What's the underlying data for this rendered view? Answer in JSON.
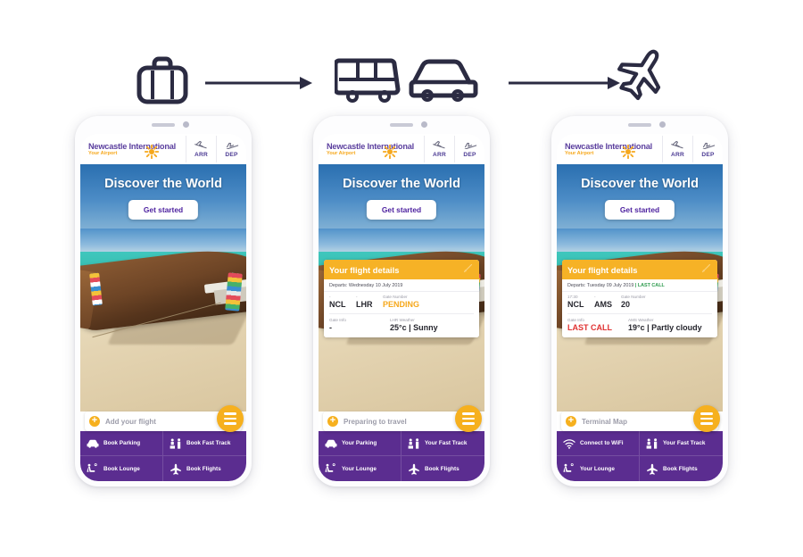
{
  "flow": {
    "steps": [
      {
        "name": "suitcase-icon",
        "label": "suitcase"
      },
      {
        "name": "arrow-1",
        "label": "arrow-right"
      },
      {
        "name": "bus-icon",
        "label": "bus"
      },
      {
        "name": "car-icon",
        "label": "car"
      },
      {
        "name": "arrow-2",
        "label": "arrow-right"
      },
      {
        "name": "plane-icon",
        "label": "airplane"
      }
    ],
    "stroke_color": "#2b2b42"
  },
  "brand": {
    "line1": "Newcastle International",
    "line2": "Your Airport",
    "color_primary": "#5b3f9e",
    "color_accent": "#f6a81c",
    "sun_icon": "sun-icon"
  },
  "header_buttons": [
    {
      "icon": "arrivals-plane-icon",
      "label": "ARR"
    },
    {
      "icon": "departures-plane-icon",
      "label": "DEP"
    }
  ],
  "hero": {
    "title": "Discover the World",
    "cta": "Get started"
  },
  "phones": [
    {
      "id": "phone-1",
      "has_flight_card": false,
      "addbar": {
        "plus": "+",
        "text": "Add your flight",
        "menu_icon": "hamburger-menu-icon"
      },
      "tiles": [
        {
          "icon": "car-icon",
          "label": "Book Parking"
        },
        {
          "icon": "fast-track-icon",
          "label": "Book Fast Track"
        },
        {
          "icon": "lounge-seat-icon",
          "label": "Book Lounge"
        },
        {
          "icon": "plane-icon",
          "label": "Book Flights"
        }
      ]
    },
    {
      "id": "phone-2",
      "has_flight_card": true,
      "card": {
        "title": "Your flight details",
        "edit_icon": "edit-pencil-icon",
        "departs_prefix": "Departs:",
        "departs_date": "Wednesday 10 July 2019",
        "departs_status": "",
        "origin_time": "-",
        "origin_code": "NCL",
        "dest_time": "-",
        "dest_code": "LHR",
        "gate_number_label": "Gate Number",
        "gate_number_value": "PENDING",
        "gate_number_state": "pending",
        "gate_info_label": "Gate Info",
        "gate_info_value": "-",
        "gate_info_state": "normal",
        "weather_label": "LHR Weather",
        "weather_value": "25°c  |  Sunny"
      },
      "addbar": {
        "plus": "+",
        "text": "Preparing to travel",
        "menu_icon": "hamburger-menu-icon"
      },
      "tiles": [
        {
          "icon": "car-icon",
          "label": "Your Parking"
        },
        {
          "icon": "fast-track-icon",
          "label": "Your Fast Track"
        },
        {
          "icon": "lounge-seat-icon",
          "label": "Your Lounge"
        },
        {
          "icon": "plane-icon",
          "label": "Book Flights"
        }
      ]
    },
    {
      "id": "phone-3",
      "has_flight_card": true,
      "card": {
        "title": "Your flight details",
        "edit_icon": "edit-pencil-icon",
        "departs_prefix": "Departs:",
        "departs_date": "Tuesday 09 July 2019",
        "departs_status": "| LAST CALL",
        "origin_time": "17:30",
        "origin_code": "NCL",
        "dest_time": "-",
        "dest_code": "AMS",
        "gate_number_label": "Gate Number",
        "gate_number_value": "20",
        "gate_number_state": "normal",
        "gate_info_label": "Gate Info",
        "gate_info_value": "LAST CALL",
        "gate_info_state": "lastcall",
        "weather_label": "AMS Weather",
        "weather_value": "19°c  |  Partly cloudy"
      },
      "addbar": {
        "plus": "+",
        "text": "Terminal Map",
        "menu_icon": "hamburger-menu-icon"
      },
      "tiles": [
        {
          "icon": "wifi-icon",
          "label": "Connect to WiFi"
        },
        {
          "icon": "fast-track-icon",
          "label": "Your Fast Track"
        },
        {
          "icon": "lounge-seat-icon",
          "label": "Your Lounge"
        },
        {
          "icon": "plane-icon",
          "label": "Book Flights"
        }
      ]
    }
  ],
  "colors": {
    "purple": "#5b2d90",
    "orange": "#f6b226",
    "yellow": "#f6b01e",
    "green": "#2e9b4e",
    "red": "#e03232"
  }
}
